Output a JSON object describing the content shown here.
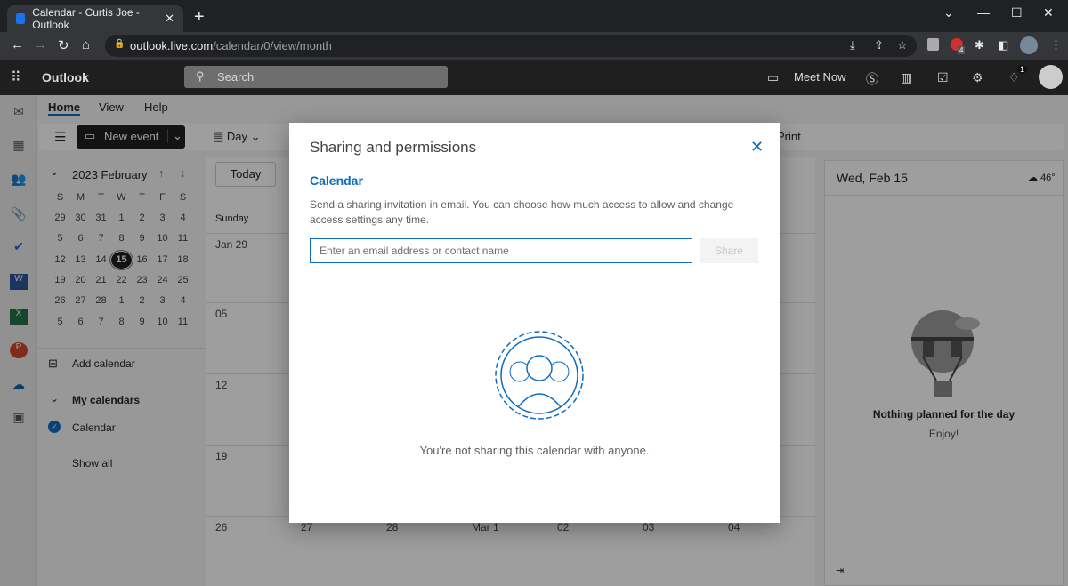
{
  "browser": {
    "tab_title": "Calendar - Curtis Joe - Outlook",
    "url_domain": "outlook.live.com",
    "url_path": "/calendar/0/view/month",
    "ext_badge": "4"
  },
  "header": {
    "app_name": "Outlook",
    "search_placeholder": "Search",
    "meet_now": "Meet Now",
    "notif_count": "1"
  },
  "ribbon": {
    "tabs": [
      "Home",
      "View",
      "Help"
    ],
    "new_event": "New event",
    "day": "Day",
    "print": "Print"
  },
  "mini_calendar": {
    "title": "2023 February",
    "weekdays": [
      "S",
      "M",
      "T",
      "W",
      "T",
      "F",
      "S"
    ],
    "weeks": [
      [
        "29",
        "30",
        "31",
        "1",
        "2",
        "3",
        "4"
      ],
      [
        "5",
        "6",
        "7",
        "8",
        "9",
        "10",
        "11"
      ],
      [
        "12",
        "13",
        "14",
        "15",
        "16",
        "17",
        "18"
      ],
      [
        "19",
        "20",
        "21",
        "22",
        "23",
        "24",
        "25"
      ],
      [
        "26",
        "27",
        "28",
        "1",
        "2",
        "3",
        "4"
      ],
      [
        "5",
        "6",
        "7",
        "8",
        "9",
        "10",
        "11"
      ]
    ],
    "selected": "15"
  },
  "sidebar": {
    "add_calendar": "Add calendar",
    "my_calendars": "My calendars",
    "calendar": "Calendar",
    "show_all": "Show all"
  },
  "grid": {
    "today": "Today",
    "first_day_header": "Sunday",
    "row_labels": [
      "Jan 29",
      "05",
      "12",
      "19",
      "26"
    ],
    "last_row": [
      "27",
      "28",
      "Mar 1",
      "02",
      "03",
      "04"
    ]
  },
  "right_pane": {
    "date": "Wed, Feb 15",
    "temp": "46°",
    "empty_title": "Nothing planned for the day",
    "empty_sub": "Enjoy!"
  },
  "modal": {
    "title": "Sharing and permissions",
    "section": "Calendar",
    "description": "Send a sharing invitation in email. You can choose how much access to allow and change access settings any time.",
    "email_placeholder": "Enter an email address or contact name",
    "share": "Share",
    "empty_text": "You're not sharing this calendar with anyone."
  },
  "colors": {
    "accent": "#0f6cbd"
  }
}
